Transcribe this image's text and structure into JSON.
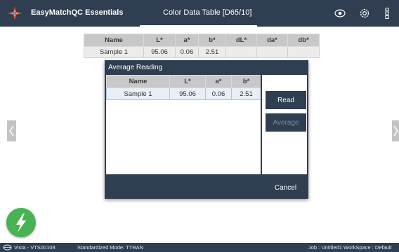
{
  "app": {
    "name": "EasyMatchQC Essentials",
    "page_title": "Color Data Table [D65/10]"
  },
  "icons": {
    "logo": "easymatchqc-logo-icon",
    "eye": "eye-icon",
    "gear": "gear-icon",
    "menu": "overflow-menu-icon",
    "left_arrow": "chevron-left-icon",
    "right_arrow": "chevron-right-icon",
    "fab": "lightning-icon",
    "status": "hunterlab-logo-icon"
  },
  "colors": {
    "bar": "#2f3e51",
    "fab": "#49b253",
    "header_cell": "#c8c8c8",
    "selected_row": "#e9eff6"
  },
  "bg_table": {
    "columns": [
      "Name",
      "L*",
      "a*",
      "b*",
      "dL*",
      "da*",
      "db*"
    ],
    "row": [
      "Sample 1",
      "95.06",
      "0.06",
      "2.51",
      "",
      "",
      ""
    ]
  },
  "dialog": {
    "title": "Average Reading",
    "columns": [
      "Name",
      "L*",
      "a*",
      "b*"
    ],
    "row": [
      "Sample 1",
      "95.06",
      "0.06",
      "2.51"
    ],
    "read_label": "Read",
    "average_label": "Average",
    "cancel_label": "Cancel"
  },
  "status": {
    "left": "Vista - VTS00108",
    "mid": "Standardized  Mode: TTRAN",
    "right": "Job : Untitled1   WorkSpace : Default"
  }
}
